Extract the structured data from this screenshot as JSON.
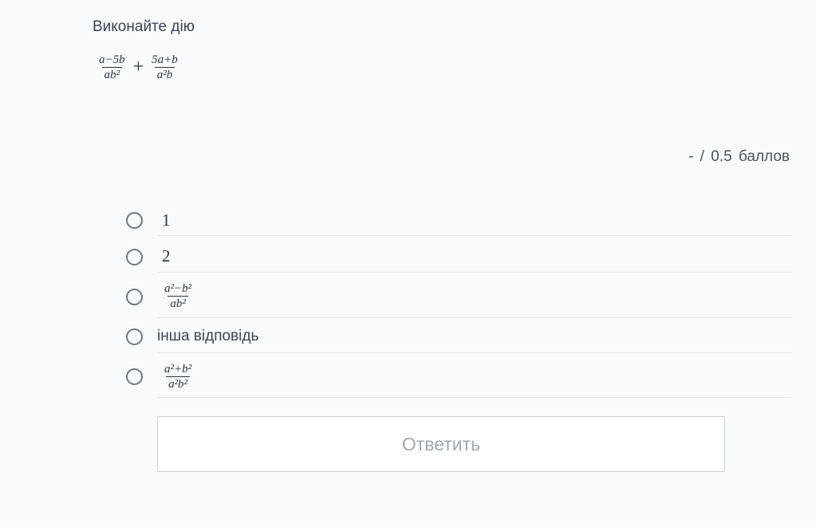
{
  "question": {
    "title": "Виконайте дію",
    "expression": {
      "left": {
        "num": "a−5b",
        "den": "ab²"
      },
      "operator": "+",
      "right": {
        "num": "5a+b",
        "den": "a²b"
      }
    }
  },
  "score": {
    "earned": "-",
    "separator": "/",
    "max": "0.5",
    "unit": "баллов"
  },
  "options": [
    {
      "kind": "number",
      "text": "1"
    },
    {
      "kind": "number",
      "text": "2"
    },
    {
      "kind": "fraction",
      "num": "a²−b²",
      "den": "ab²"
    },
    {
      "kind": "text",
      "text": "інша відповідь"
    },
    {
      "kind": "fraction",
      "num": "a²+b²",
      "den": "a²b²"
    }
  ],
  "submit": {
    "label": "Ответить"
  }
}
